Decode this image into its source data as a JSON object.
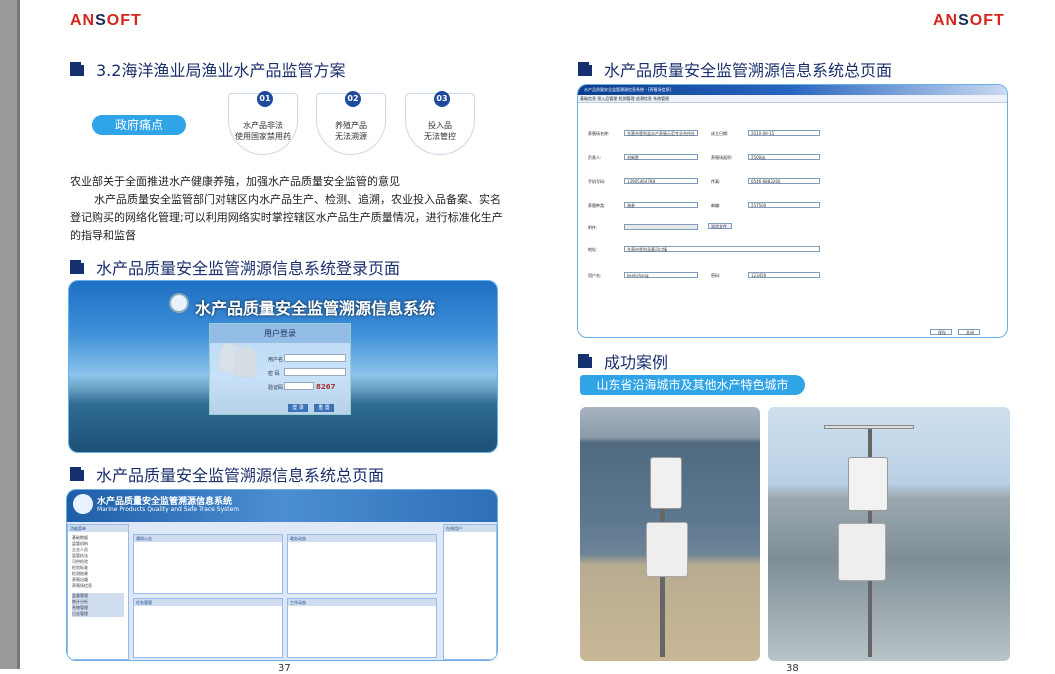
{
  "brand": {
    "logo_a": "AN",
    "logo_b": "S",
    "logo_c": "OFT"
  },
  "left": {
    "section1": "3.2海洋渔业局渔业水产品监管方案",
    "pain_label": "政府痛点",
    "pains": [
      {
        "num": "01",
        "line1": "水产品非法",
        "line2": "使用国家禁用药"
      },
      {
        "num": "02",
        "line1": "养殖产品",
        "line2": "无法溯源"
      },
      {
        "num": "03",
        "line1": "投入品",
        "line2": "无法管控"
      }
    ],
    "para1": "农业部关于全面推进水产健康养殖，加强水产品质量安全监管的意见",
    "para2": "水产品质量安全监管部门对辖区内水产品生产、检测、追溯，农业投入品备案、实名登记购买的网络化管理;可以利用网络实时掌控辖区水产品生产质量情况，进行标准化生产的指导和监督",
    "section2": "水产品质量安全监管溯源信息系统登录页面",
    "section3": "水产品质量安全监管溯源信息系统总页面",
    "page": "37"
  },
  "login": {
    "title": "水产品质量安全监管溯源信息系统",
    "box_title": "用户登录",
    "user": "用户名",
    "pass": "密 码",
    "code": "验证码",
    "code_val": "8267",
    "btn_login": "登 录",
    "btn_reset": "重 置"
  },
  "admin": {
    "title": "水产品质量安全监管溯源信息系统",
    "subtitle": "Marine Products Quality and Safe Trace System",
    "side_title": "功能菜单",
    "side_items": [
      "基础数据",
      "监管机构",
      "企业人员",
      "监管执法",
      "可供检验",
      "检验标准",
      "检测结果",
      "养殖出塘",
      "养殖场信息"
    ],
    "side_groups": [
      "监督管理",
      "统计分析",
      "系统管理",
      "日志管理"
    ],
    "panels": [
      "通知公告",
      "政务动态",
      "任务管理",
      "工作动态"
    ],
    "right": "在线用户"
  },
  "right": {
    "section1": "水产品质量安全监管溯源信息系统总页面",
    "section2": "成功案例",
    "case_label": "山东省沿海城市及其他水产特色城市",
    "page": "38"
  },
  "form": {
    "window_title": "水产品质量安全监管溯源信息系统 - [养殖场信息]",
    "menu": "基础信息  投入品管理  检测管理  追溯信息  系统管理",
    "fields": [
      {
        "label": "养殖场名称:",
        "value": "东营市垦利县水产养殖示范专业合作社"
      },
      {
        "label": "成立日期:",
        "value": "2010-09-15"
      },
      {
        "label": "负责人:",
        "value": "刘新胜"
      },
      {
        "label": "养殖场面积:",
        "value": "2500亩"
      },
      {
        "label": "手机号码:",
        "value": "13905464788"
      },
      {
        "label": "传真:",
        "value": "0546-6883260"
      },
      {
        "label": "养殖种类:",
        "value": "海参"
      },
      {
        "label": "邮编:",
        "value": "257500"
      },
      {
        "label": "附件:",
        "value": ""
      },
      {
        "label": "地址:",
        "value": "东营市垦利县黄河口镇"
      },
      {
        "label": "用户名:",
        "value": "kenlishang"
      },
      {
        "label": "密码:",
        "value": "123456"
      }
    ],
    "browse": "浏览文件",
    "save": "保存",
    "close": "关闭"
  },
  "colors": {
    "accent": "#2fa4e7",
    "navy": "#1b2f6b",
    "brand_red": "#d6251c"
  }
}
